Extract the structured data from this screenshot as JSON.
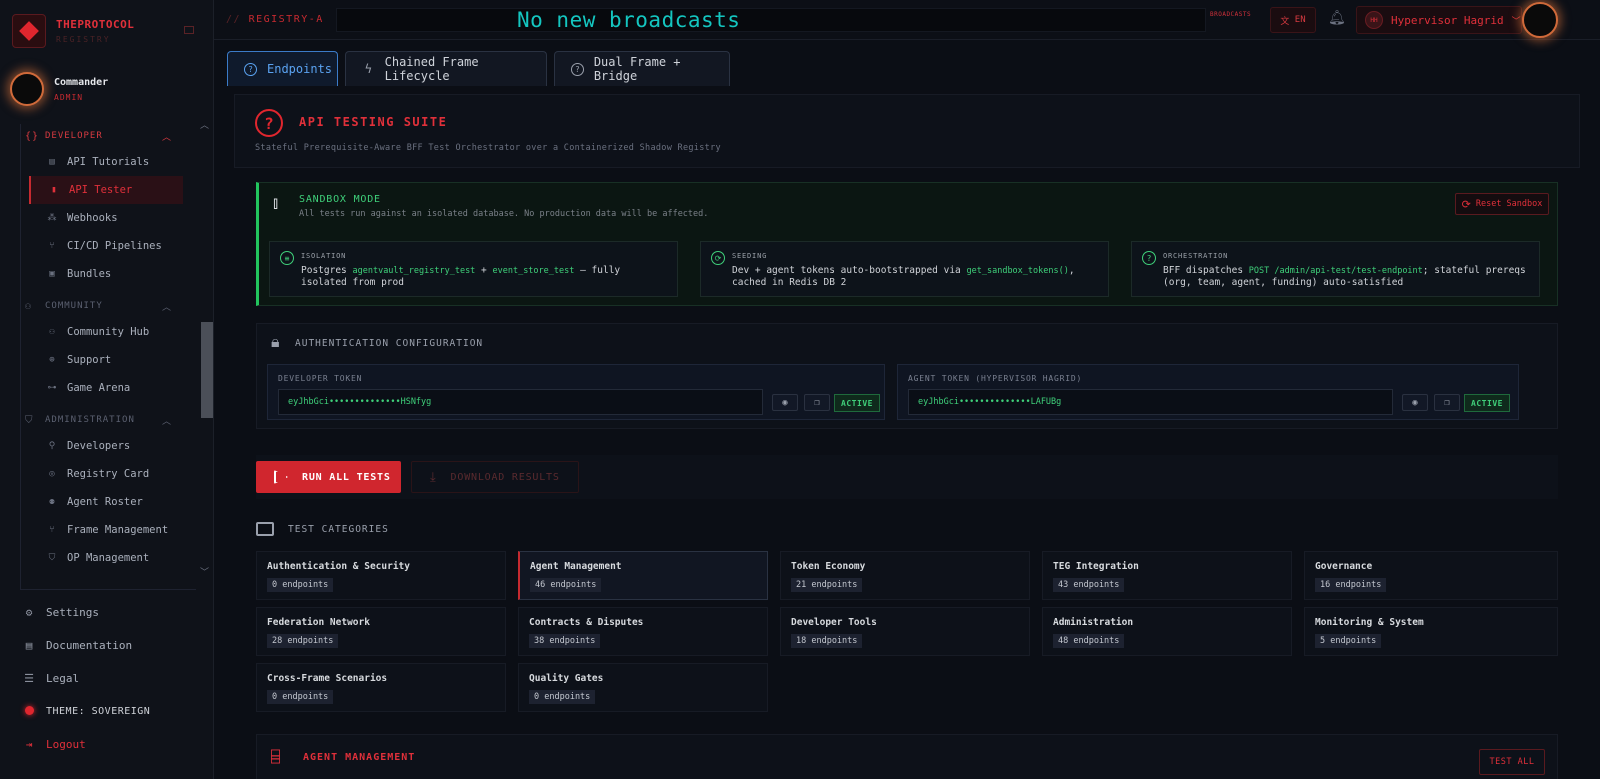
{
  "brand": {
    "name": "THEPROTOCOL",
    "sub": "REGISTRY"
  },
  "user": {
    "name": "Commander",
    "role": "ADMIN"
  },
  "nav": {
    "developer_label": "DEVELOPER",
    "developer_items": [
      {
        "label": "API Tutorials",
        "icon": "book-icon"
      },
      {
        "label": "API Tester",
        "icon": "flask-icon"
      },
      {
        "label": "Webhooks",
        "icon": "webhook-icon"
      },
      {
        "label": "CI/CD Pipelines",
        "icon": "branch-icon"
      },
      {
        "label": "Bundles",
        "icon": "package-icon"
      }
    ],
    "community_label": "COMMUNITY",
    "community_items": [
      {
        "label": "Community Hub",
        "icon": "users-icon"
      },
      {
        "label": "Support",
        "icon": "lifebuoy-icon"
      },
      {
        "label": "Game Arena",
        "icon": "gamepad-icon"
      }
    ],
    "administration_label": "ADMINISTRATION",
    "administration_items": [
      {
        "label": "Developers",
        "icon": "user-plus-icon"
      },
      {
        "label": "Registry Card",
        "icon": "fingerprint-icon"
      },
      {
        "label": "Agent Roster",
        "icon": "user-icon"
      },
      {
        "label": "Frame Management",
        "icon": "branch-icon"
      },
      {
        "label": "OP Management",
        "icon": "shield-icon"
      }
    ]
  },
  "bottom_nav": {
    "settings": "Settings",
    "documentation": "Documentation",
    "legal": "Legal",
    "theme": "THEME: SOVEREIGN",
    "logout": "Logout"
  },
  "topbar": {
    "crumb_prefix": "//",
    "crumb": "REGISTRY-A",
    "broadcast": "No new broadcasts",
    "broadcast_tag": "BROADCASTS",
    "lang": "EN",
    "user_initials": "HH",
    "user_name": "Hypervisor Hagrid"
  },
  "tabs": [
    {
      "label": "Endpoints"
    },
    {
      "label": "Chained Frame Lifecycle"
    },
    {
      "label": "Dual Frame + Bridge"
    }
  ],
  "suite": {
    "title": "API TESTING SUITE",
    "subtitle": "Stateful Prerequisite-Aware BFF Test Orchestrator over a Containerized Shadow Registry"
  },
  "sandbox": {
    "title": "SANDBOX MODE",
    "subtitle": "All tests run against an isolated database. No production data will be affected.",
    "reset": "Reset Sandbox",
    "isolation": {
      "title": "ISOLATION",
      "t1": "Postgres ",
      "c1": "agentvault_registry_test",
      "t2": " + ",
      "c2": "event_store_test",
      "t3": " — fully isolated from prod"
    },
    "seeding": {
      "title": "SEEDING",
      "t1": "Dev + agent tokens auto-bootstrapped via ",
      "c1": "get_sandbox_tokens()",
      "t2": ", cached in Redis DB 2"
    },
    "orchestration": {
      "title": "ORCHESTRATION",
      "t1": "BFF dispatches ",
      "c1": "POST /admin/api-test/test-endpoint",
      "t2": "; stateful prereqs (org, team, agent, funding) auto-satisfied"
    }
  },
  "auth": {
    "title": "AUTHENTICATION CONFIGURATION",
    "dev_label": "DEVELOPER TOKEN",
    "dev_value": "eyJhbGci••••••••••••••HSNfyg",
    "agent_label": "AGENT TOKEN (HYPERVISOR HAGRID)",
    "agent_value": "eyJhbGci••••••••••••••LAFUBg",
    "active": "ACTIVE"
  },
  "actions": {
    "run": "RUN ALL TESTS",
    "download": "DOWNLOAD RESULTS"
  },
  "categories_title": "TEST CATEGORIES",
  "categories": [
    {
      "name": "Authentication & Security",
      "count": "0 endpoints"
    },
    {
      "name": "Agent Management",
      "count": "46 endpoints"
    },
    {
      "name": "Token Economy",
      "count": "21 endpoints"
    },
    {
      "name": "TEG Integration",
      "count": "43 endpoints"
    },
    {
      "name": "Governance",
      "count": "16 endpoints"
    },
    {
      "name": "Federation Network",
      "count": "28 endpoints"
    },
    {
      "name": "Contracts & Disputes",
      "count": "38 endpoints"
    },
    {
      "name": "Developer Tools",
      "count": "18 endpoints"
    },
    {
      "name": "Administration",
      "count": "48 endpoints"
    },
    {
      "name": "Monitoring & System",
      "count": "5 endpoints"
    },
    {
      "name": "Cross-Frame Scenarios",
      "count": "0 endpoints"
    },
    {
      "name": "Quality Gates",
      "count": "0 endpoints"
    }
  ],
  "agent_mgmt": {
    "title": "AGENT MANAGEMENT",
    "test_all": "TEST ALL"
  },
  "colors": {
    "accent": "#e0262e",
    "success": "#3fd07a",
    "info": "#5aa2f0",
    "broadcast": "#14c6c0"
  }
}
